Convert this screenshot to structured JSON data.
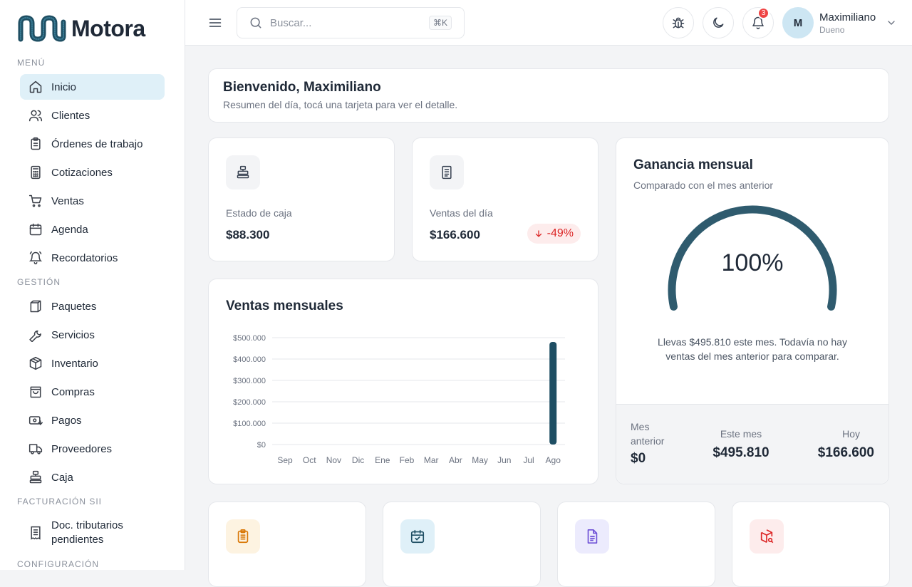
{
  "brand": {
    "name": "Motora"
  },
  "sidebar": {
    "sections": [
      {
        "label": "MENÚ"
      },
      {
        "label": "GESTIÓN"
      },
      {
        "label": "FACTURACIÓN SII"
      },
      {
        "label": "CONFIGURACIÓN"
      }
    ],
    "items": [
      {
        "label": "Inicio",
        "icon": "home-icon"
      },
      {
        "label": "Clientes",
        "icon": "users-icon"
      },
      {
        "label": "Órdenes de trabajo",
        "icon": "clipboard-icon"
      },
      {
        "label": "Cotizaciones",
        "icon": "calculator-icon"
      },
      {
        "label": "Ventas",
        "icon": "cart-icon"
      },
      {
        "label": "Agenda",
        "icon": "calendar-icon"
      },
      {
        "label": "Recordatorios",
        "icon": "bell-ring-icon"
      },
      {
        "label": "Paquetes",
        "icon": "package-icon"
      },
      {
        "label": "Servicios",
        "icon": "wrench-icon"
      },
      {
        "label": "Inventario",
        "icon": "boxes-icon"
      },
      {
        "label": "Compras",
        "icon": "shopping-bag-icon"
      },
      {
        "label": "Pagos",
        "icon": "payment-icon"
      },
      {
        "label": "Proveedores",
        "icon": "truck-icon"
      },
      {
        "label": "Caja",
        "icon": "cash-register-icon"
      },
      {
        "label": "Doc. tributarios pendientes",
        "icon": "receipt-icon"
      }
    ]
  },
  "topbar": {
    "search_placeholder": "Buscar...",
    "search_shortcut": "⌘K",
    "notifications_count": "3",
    "user": {
      "initial": "M",
      "name": "Maximiliano",
      "role": "Dueno"
    }
  },
  "welcome": {
    "title": "Bienvenido, Maximiliano",
    "subtitle": "Resumen del día, tocá una tarjeta para ver el detalle."
  },
  "stats": {
    "caja": {
      "label": "Estado de caja",
      "value": "$88.300"
    },
    "ventas_dia": {
      "label": "Ventas del día",
      "value": "$166.600",
      "delta": "-49%"
    }
  },
  "chart_data": {
    "type": "bar",
    "title": "Ventas mensuales",
    "categories": [
      "Sep",
      "Oct",
      "Nov",
      "Dic",
      "Ene",
      "Feb",
      "Mar",
      "Abr",
      "May",
      "Jun",
      "Jul",
      "Ago"
    ],
    "values": [
      0,
      0,
      0,
      0,
      0,
      0,
      0,
      0,
      0,
      0,
      0,
      480000
    ],
    "y_ticks": [
      "$0",
      "$100.000",
      "$200.000",
      "$300.000",
      "$400.000",
      "$500.000"
    ],
    "ylim": [
      0,
      500000
    ],
    "grid": true,
    "color": "#1e4e63"
  },
  "gauge": {
    "title": "Ganancia mensual",
    "subtitle": "Comparado con el mes anterior",
    "value": "100%",
    "fraction": 1.0,
    "color": "#2f5b6e",
    "message": "Llevas $495.810 este mes. Todavía no hay ventas del mes anterior para comparar.",
    "footer": {
      "prev_label": "Mes anterior",
      "prev_value": "$0",
      "month_label": "Este mes",
      "month_value": "$495.810",
      "today_label": "Hoy",
      "today_value": "$166.600"
    }
  },
  "colors": {
    "accent": "#dff0f8",
    "danger": "#dc2626",
    "mini_icons": [
      "#fdf3e1",
      "#dff0f8",
      "#ecebfd",
      "#fdecec"
    ]
  }
}
